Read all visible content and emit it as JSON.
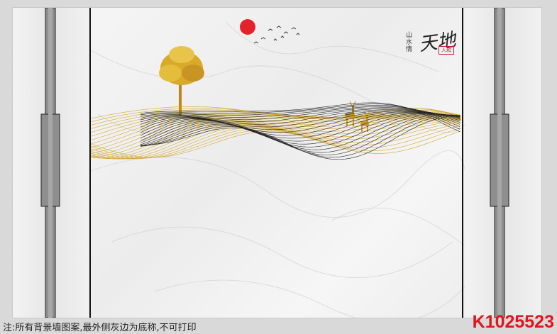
{
  "artwork": {
    "calligraphy_main": "天地",
    "calligraphy_small": "山水情",
    "seal_text": "人和"
  },
  "footer": {
    "note": "注:所有背景墙图案,最外侧灰边为底称,不可打印",
    "product_code": "K1025523"
  },
  "colors": {
    "background_gray": "#d9d9d9",
    "sun_red": "#e4222c",
    "gold": "#d4a62a",
    "line_dark": "#222222",
    "code_red": "#e0151d"
  }
}
